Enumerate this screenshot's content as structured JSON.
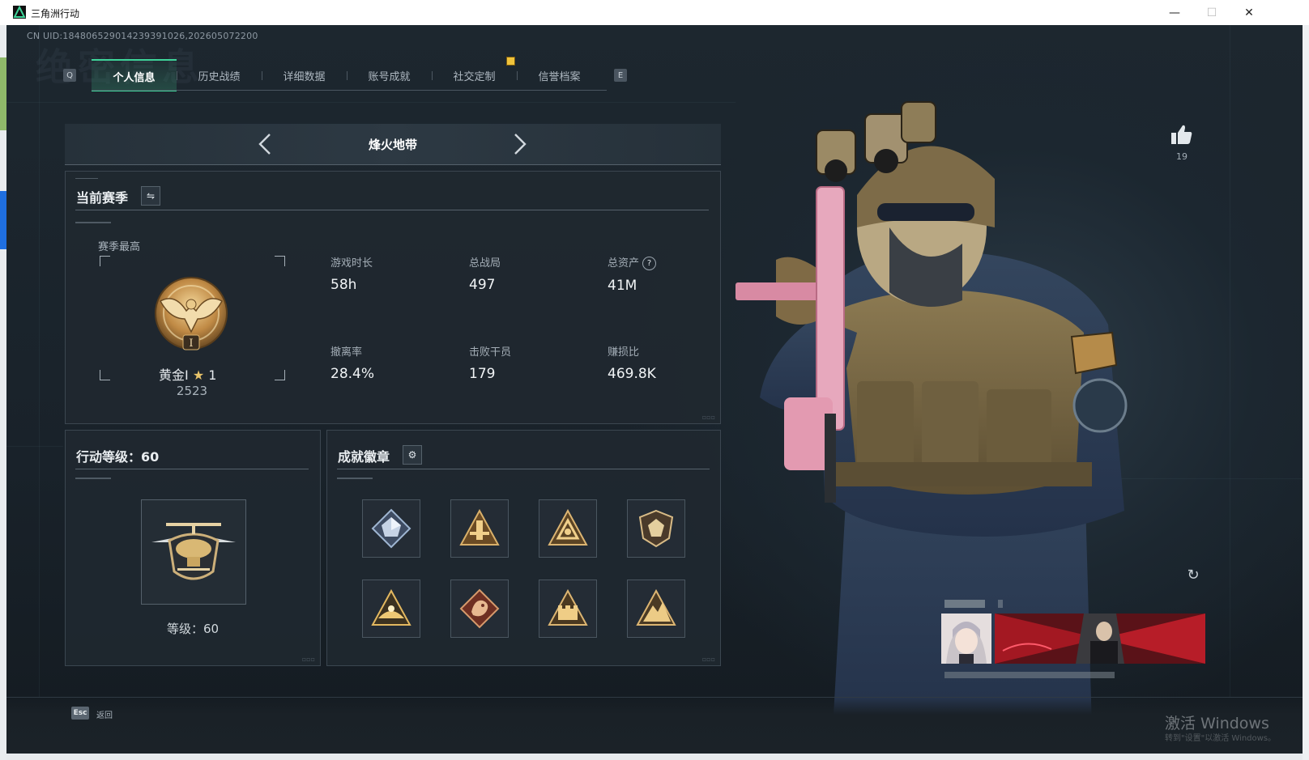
{
  "window": {
    "title": "三角洲行动",
    "minimize": "—",
    "maximize": "☐",
    "close": "✕"
  },
  "uid_text": "CN UID:18480652901423939102​6,202605072200",
  "watermark": "绝密信息",
  "tabs": {
    "key_left": "Q",
    "key_right": "E",
    "items": [
      {
        "label": "个人信息",
        "active": true
      },
      {
        "label": "历史战绩",
        "active": false
      },
      {
        "label": "详细数据",
        "active": false
      },
      {
        "label": "账号成就",
        "active": false
      },
      {
        "label": "社交定制",
        "active": false
      },
      {
        "label": "信誉档案",
        "active": false
      }
    ]
  },
  "mode": {
    "title": "烽火地带",
    "prev": "‹",
    "next": "›"
  },
  "season": {
    "title": "当前赛季",
    "switch_icon": "⇋",
    "best_label": "赛季最高",
    "rank_name": "黄金Ⅰ",
    "rank_star": "★",
    "rank_stars_count": "1",
    "rank_score": "2523",
    "stats": [
      {
        "label": "游戏时长",
        "value": "58h"
      },
      {
        "label": "总战局",
        "value": "497"
      },
      {
        "label": "总资产",
        "value": "41M",
        "help": "?"
      },
      {
        "label": "撤离率",
        "value": "28.4%"
      },
      {
        "label": "击败干员",
        "value": "179"
      },
      {
        "label": "赚损比",
        "value": "469.8K"
      }
    ]
  },
  "level": {
    "title": "行动等级：60",
    "level_text": "等级：60"
  },
  "achievements": {
    "title": "成就徽章",
    "settings_icon": "⚙"
  },
  "like": {
    "count": "19"
  },
  "refresh_icon": "↻",
  "bottom": {
    "esc_key": "Esc",
    "esc_label": "返回"
  },
  "os_watermark": {
    "line1": "激活 Windows",
    "line2": "转到\"设置\"以激活 Windows。"
  },
  "colors": {
    "accent": "#3fd49a",
    "gold": "#c9a35a",
    "panel": "#1f2830"
  }
}
